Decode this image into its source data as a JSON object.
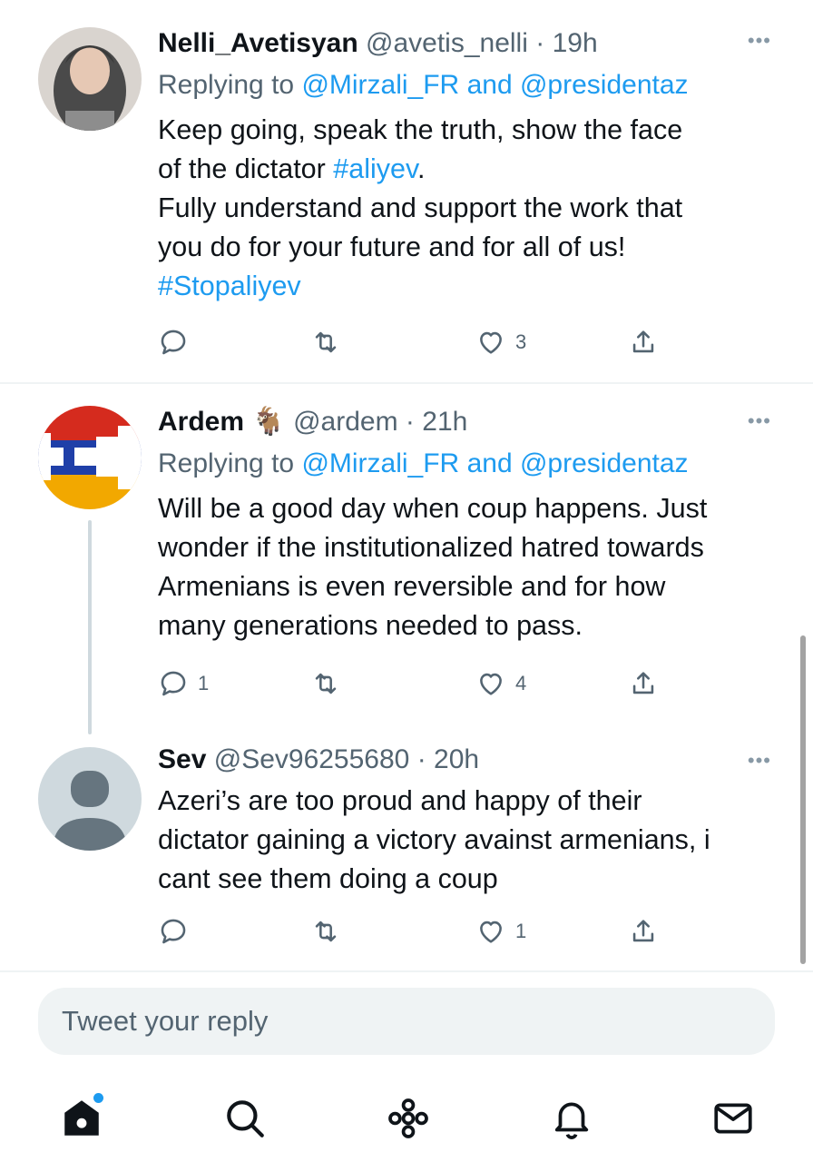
{
  "tweets": [
    {
      "display_name": "Nelli_Avetisyan",
      "handle": "@avetis_nelli",
      "separator": "·",
      "time": "19h",
      "replying_prefix": "Replying to ",
      "reply_user_1": "@Mirzali_FR",
      "reply_and": " and ",
      "reply_user_2": "@presidentaz",
      "text_line_1": "Keep going, speak the truth, show the face",
      "text_line_2_pre": "of the dictator ",
      "text_line_2_tag": "#aliyev",
      "text_line_2_post": ".",
      "text_line_3": "Fully understand and support the work that",
      "text_line_4": "you do for your future and for all of us!",
      "text_line_5_tag": "#Stopaliyev",
      "reply_count": "",
      "retweet_count": "",
      "like_count": "3"
    },
    {
      "display_name": "Ardem",
      "name_emoji": "🐐",
      "handle": "@ardem",
      "separator": "·",
      "time": "21h",
      "replying_prefix": "Replying to ",
      "reply_user_1": "@Mirzali_FR",
      "reply_and": " and ",
      "reply_user_2": "@presidentaz",
      "text_line_1": "Will be a good day when coup happens. Just",
      "text_line_2": "wonder if the institutionalized hatred towards",
      "text_line_3": "Armenians is even reversible and for how",
      "text_line_4": "many generations needed to pass.",
      "reply_count": "1",
      "retweet_count": "",
      "like_count": "4"
    },
    {
      "display_name": "Sev",
      "handle": "@Sev96255680",
      "separator": "·",
      "time": "20h",
      "text_line_1": "Azeri’s are too proud and happy of their",
      "text_line_2": "dictator gaining a victory avainst armenians, i",
      "text_line_3": "cant see them doing a coup",
      "reply_count": "",
      "retweet_count": "",
      "like_count": "1"
    }
  ],
  "more_glyph": "•••",
  "reply_box": {
    "placeholder": "Tweet your reply"
  },
  "nav": [
    "home-icon",
    "search-icon",
    "spaces-icon",
    "bell-icon",
    "mail-icon"
  ],
  "colors": {
    "accent": "#1d9bf0",
    "text": "#0f1419",
    "muted": "#536471",
    "divider": "#eff3f4"
  }
}
